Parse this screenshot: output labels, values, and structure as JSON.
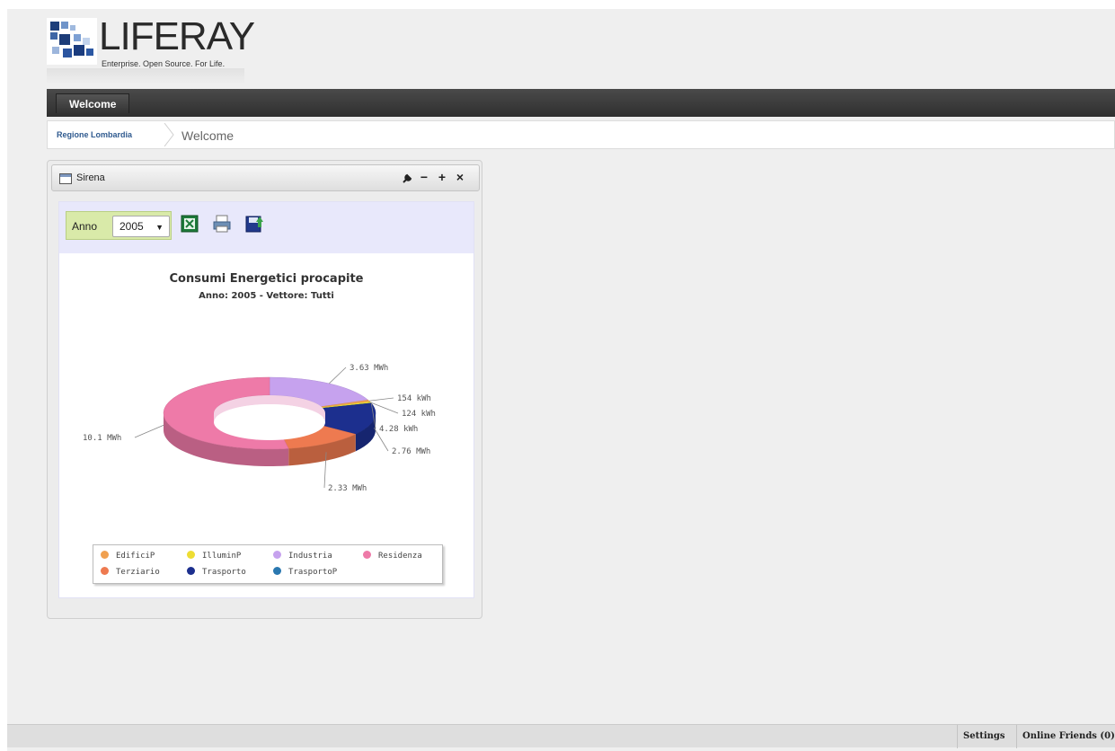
{
  "header": {
    "logo_text": "LIFERAY",
    "tagline": "Enterprise. Open Source. For Life."
  },
  "navbar": {
    "tabs": [
      {
        "label": "Welcome"
      }
    ]
  },
  "breadcrumb": {
    "root": "Regione Lombardia",
    "current": "Welcome"
  },
  "portlet": {
    "title": "Sirena",
    "controls": {
      "configure": "wrench-icon",
      "minimize": "−",
      "maximize": "+",
      "close": "×"
    },
    "toolbar": {
      "anno_label": "Anno",
      "anno_value": "2005",
      "icons": [
        "excel-export-icon",
        "print-icon",
        "save-icon"
      ]
    }
  },
  "chart_data": {
    "type": "pie",
    "variant": "3d-donut",
    "title": "Consumi Energetici procapite",
    "subtitle": "Anno: 2005 - Vettore: Tutti",
    "slices": [
      {
        "label": "Industria",
        "value": 3.63,
        "unit": "MWh",
        "display": "3.63 MWh",
        "color": "#c6a2ee"
      },
      {
        "label": "EdificiP",
        "value": 0.154,
        "unit": "MWh",
        "display": "154 kWh",
        "color": "#f0a050"
      },
      {
        "label": "IlluminP",
        "value": 0.124,
        "unit": "MWh",
        "display": "124 kWh",
        "color": "#eedd33"
      },
      {
        "label": "TrasportoP",
        "value": 0.00428,
        "unit": "MWh",
        "display": "4.28 kWh",
        "color": "#2a78b0"
      },
      {
        "label": "Trasporto",
        "value": 2.76,
        "unit": "MWh",
        "display": "2.76 MWh",
        "color": "#1c2f8e"
      },
      {
        "label": "Terziario",
        "value": 2.33,
        "unit": "MWh",
        "display": "2.33 MWh",
        "color": "#ee7a50"
      },
      {
        "label": "Residenza",
        "value": 10.1,
        "unit": "MWh",
        "display": "10.1 MWh",
        "color": "#ee7aa8"
      }
    ],
    "legend": {
      "placement": "bottom",
      "items": [
        "EdificiP",
        "IlluminP",
        "Industria",
        "Residenza",
        "Terziario",
        "Trasporto",
        "TrasportoP"
      ]
    }
  },
  "dock": {
    "settings": "Settings",
    "online_friends": "Online Friends (0)"
  }
}
